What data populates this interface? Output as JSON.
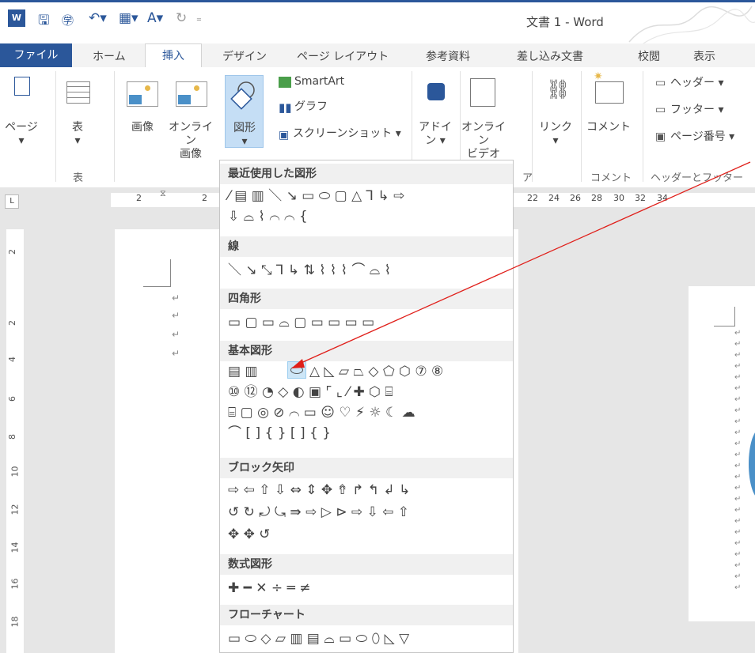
{
  "window": {
    "title": "文書 1 - Word",
    "app_icon": "W"
  },
  "quick_access": {
    "icons": [
      "save-icon",
      "touch-mode-icon",
      "undo-icon",
      "table-icon",
      "font-color-icon",
      "redo-icon",
      "customize-icon"
    ]
  },
  "tabs": {
    "file": "ファイル",
    "home": "ホーム",
    "insert": "挿入",
    "design": "デザイン",
    "layout": "ページ レイアウト",
    "references": "参考資料",
    "mailings": "差し込み文書",
    "review": "校閲",
    "view": "表示"
  },
  "ribbon": {
    "pages": "ページ",
    "table": "表",
    "table_group": "表",
    "picture": "画像",
    "online_picture_1": "オンライン",
    "online_picture_2": "画像",
    "shapes": "図形",
    "smartart": "SmartArt",
    "chart": "グラフ",
    "screenshot": "スクリーンショット ▾",
    "addins_1": "アドイ",
    "addins_2": "ン ▾",
    "online_video_1": "オンライン",
    "online_video_2": "ビデオ",
    "link": "リンク",
    "comment": "コメント",
    "comment_group": "コメント",
    "header": "ヘッダー ▾",
    "footer": "フッター ▾",
    "page_number": "ページ番号 ▾",
    "header_footer_group": "ヘッダーとフッター",
    "partial_group_suffix": "ア"
  },
  "ruler": {
    "ticks_left": [
      "2",
      "2"
    ],
    "ticks_right": [
      "22",
      "24",
      "26",
      "28",
      "30",
      "32",
      "34"
    ]
  },
  "vruler": [
    "2",
    "2",
    "4",
    "6",
    "8",
    "10",
    "12",
    "14",
    "16",
    "18"
  ],
  "dropdown": {
    "recent": "最近使用した図形",
    "lines": "線",
    "rectangles": "四角形",
    "basic": "基本図形",
    "block_arrows": "ブロック矢印",
    "equation": "数式図形",
    "flowchart": "フローチャート",
    "recent_row1": "⁄ ▤ ▥ ＼ ↘ ▭ ⬭ ▢ △ ⅂ ↳ ⇨",
    "recent_row2": "⇩ ⌓ ⌇ ⌒ ⌒ {",
    "lines_row": "＼ ↘ ⤡ ⅂ ↳ ⇅ ⌇ ⌇ ⌇ ⌒ ⌓ ⌇",
    "rect_row": "▭ ▢ ▭ ⌓ ▢ ▭ ▭ ▭ ▭",
    "basic_row1": "▤ ▥",
    "basic_row1_rest": "△ ◺ ▱ ⏢ ◇ ⬠ ⬡ ⑦ ⑧",
    "basic_row2": "⑩ ⑫ ◔ ◇ ◐ ▣ ⌜ ⌞ ⁄ ✚ ⬡ ⌸",
    "basic_row3": "⌸ ▢ ◎ ⊘ ⌒ ▭ ☺ ♡ ⚡ ☼ ☾ ☁",
    "basic_row4": "⌒ [ ] { } [ ] { }",
    "arrow_row1": "⇨ ⇦ ⇧ ⇩ ⇔ ⇕ ✥ ⇮ ↱ ↰ ↲ ↳",
    "arrow_row2": "↺ ↻ ⤾ ⤿ ⇛ ⇨ ▷ ⊳ ⇨ ⇩ ⇦ ⇧",
    "arrow_row3": "✥ ✥ ↺",
    "eq_row": "✚ ━ ✕ ÷ ═ ≠",
    "flow_row": "▭ ⬭ ◇ ▱ ▥ ▤ ⌓ ▭ ⬭ ⬯ ◺ ▽"
  },
  "return_mark": "↵",
  "colors": {
    "brand": "#2b579a",
    "highlight": "#cde6f7",
    "arrow": "#e0201b"
  }
}
